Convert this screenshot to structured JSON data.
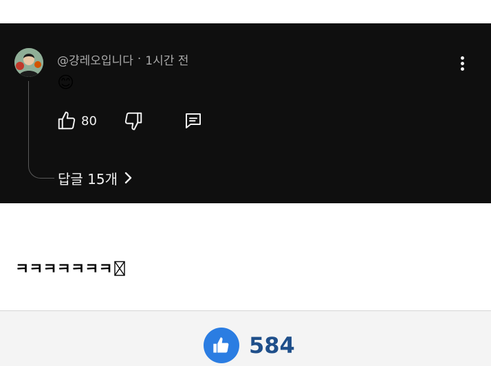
{
  "comment": {
    "author": "@걍레오입니다",
    "separator": "·",
    "time_ago": "1시간 전",
    "text": "😊",
    "like_count": "80",
    "replies_label": "답글 15개"
  },
  "post": {
    "text": "ㅋㅋㅋㅋㅋㅋㅋ"
  },
  "reaction": {
    "like_count": "584"
  },
  "colors": {
    "panel_bg": "#0f0f0f",
    "like_blue": "#2b7de2",
    "count_blue": "#1f4f8a"
  },
  "icons": [
    "avatar",
    "thumbs-up-icon",
    "thumbs-down-icon",
    "reply-icon",
    "more-vert-icon",
    "chevron-right-icon",
    "missing-glyph-icon",
    "like-circle-icon"
  ]
}
